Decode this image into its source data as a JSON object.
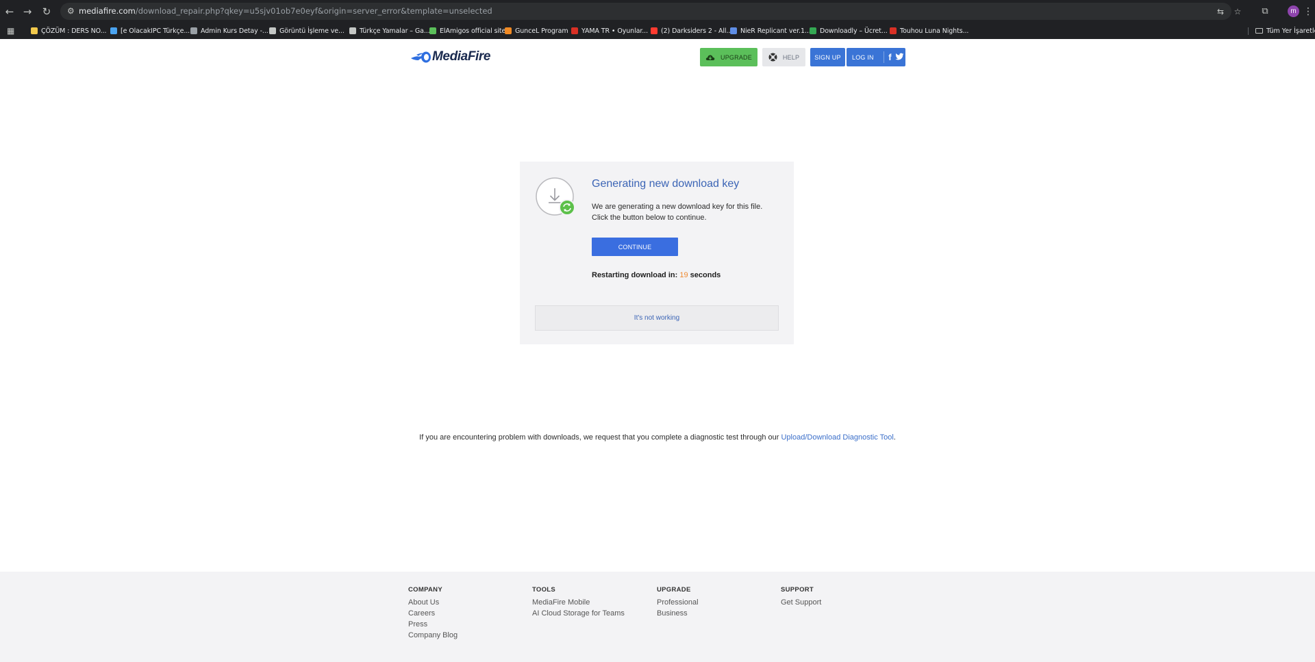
{
  "browser": {
    "url_host": "mediafire.com",
    "url_path": "/download_repair.php?qkey=u5sjv01ob7e0eyf&origin=server_error&template=unselected",
    "profile_initial": "m",
    "bookmarks": [
      {
        "label": "ÇÖZÜM : DERS NO...",
        "color": "#f2c94c"
      },
      {
        "label": "[e OlacakIPC Türkçe...",
        "color": "#4aa3f0"
      },
      {
        "label": "Admin Kurs Detay -...",
        "color": "#9aa0a6"
      },
      {
        "label": "Görüntü İşleme ve...",
        "color": "#c4c7c5"
      },
      {
        "label": "Türkçe Yamalar – Ga...",
        "color": "#c4c7c5"
      },
      {
        "label": "ElAmigos official site",
        "color": "#5bbf5a"
      },
      {
        "label": "GunceL Program",
        "color": "#f08a24"
      },
      {
        "label": "YAMA TR • Oyunlar...",
        "color": "#d93025"
      },
      {
        "label": "(2) Darksiders 2 - All...",
        "color": "#ff3b30"
      },
      {
        "label": "NieR Replicant ver.1...",
        "color": "#5f8ee6"
      },
      {
        "label": "Downloadly – Ücret...",
        "color": "#34a853"
      },
      {
        "label": "Touhou Luna Nights...",
        "color": "#d93025"
      }
    ],
    "all_bookmarks_label": "Tüm Yer İşaretleri"
  },
  "header": {
    "logo_text": "MediaFire",
    "upgrade_label": "UPGRADE",
    "help_label": "HELP",
    "signup_label": "SIGN UP",
    "login_label": "LOG IN"
  },
  "card": {
    "title": "Generating new download key",
    "message_line1": "We are generating a new download key for this file.",
    "message_line2": "Click the button below to continue.",
    "continue_label": "CONTINUE",
    "restart_prefix": "Restarting download in:",
    "restart_seconds": "19",
    "restart_suffix": "seconds",
    "not_working_label": "It's not working"
  },
  "diagnostic": {
    "text": "If you are encountering problem with downloads, we request that you complete a diagnostic test through our",
    "link_label": "Upload/Download Diagnostic Tool",
    "trailing": "."
  },
  "footer": {
    "columns": [
      {
        "heading": "COMPANY",
        "links": [
          "About Us",
          "Careers",
          "Press",
          "Company Blog"
        ]
      },
      {
        "heading": "TOOLS",
        "links": [
          "MediaFire Mobile",
          "AI Cloud Storage for Teams"
        ]
      },
      {
        "heading": "UPGRADE",
        "links": [
          "Professional",
          "Business"
        ]
      },
      {
        "heading": "SUPPORT",
        "links": [
          "Get Support"
        ]
      }
    ]
  },
  "colors": {
    "brand_blue": "#3a74d6",
    "upgrade_green": "#5bbf5a",
    "title_blue": "#3b64b5",
    "countdown_orange": "#f0892f"
  }
}
